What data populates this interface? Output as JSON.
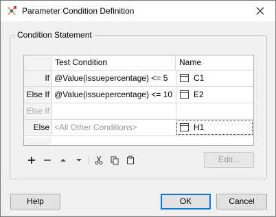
{
  "window": {
    "title": "Parameter Condition Definition"
  },
  "group": {
    "legend": "Condition Statement"
  },
  "table": {
    "headers": {
      "test_condition": "Test Condition",
      "name": "Name"
    },
    "rows": [
      {
        "label": "If",
        "condition": "@Value(issuepercentage) <= 5",
        "name": "C1",
        "enabled": true
      },
      {
        "label": "Else If",
        "condition": "@Value(issuepercentage) <= 10",
        "name": "E2",
        "enabled": true
      },
      {
        "label": "Else If",
        "condition": "",
        "name": "",
        "enabled": false
      },
      {
        "label": "Else",
        "condition": "<All Other Conditions>",
        "name": "H1",
        "enabled": true
      }
    ]
  },
  "toolbar": {
    "edit_label": "Edit..."
  },
  "footer": {
    "help_label": "Help",
    "ok_label": "OK",
    "cancel_label": "Cancel"
  },
  "colors": {
    "default_button_border": "#0078d7"
  }
}
